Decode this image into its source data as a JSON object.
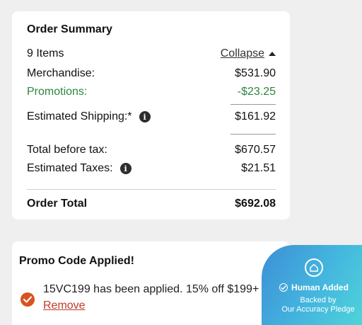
{
  "summary": {
    "title": "Order Summary",
    "items_count": "9 Items",
    "collapse_label": "Collapse",
    "merchandise": {
      "label": "Merchandise:",
      "value": "$531.90"
    },
    "promotions": {
      "label": "Promotions:",
      "value": "-$23.25"
    },
    "shipping": {
      "label": "Estimated Shipping:*",
      "value": "$161.92"
    },
    "before_tax": {
      "label": "Total before tax:",
      "value": "$670.57"
    },
    "taxes": {
      "label": "Estimated Taxes:",
      "value": "$21.51"
    },
    "order_total": {
      "label": "Order Total",
      "value": "$692.08"
    }
  },
  "promo": {
    "title": "Promo Code Applied!",
    "message": "15VC199 has been applied. 15% off $199+",
    "remove_label": "Remove"
  },
  "pledge": {
    "headline": "Human Added",
    "line1": "Backed by",
    "line2": "Our Accuracy Pledge"
  },
  "colors": {
    "promotion_green": "#2e8540",
    "accent_orange": "#d9531e",
    "remove_red": "#c0392b",
    "badge_blue": "#3d8fd6",
    "badge_teal": "#4fd3da"
  },
  "icons": {
    "info": "info-icon",
    "caret": "caret-up-icon",
    "check": "checkmark-icon",
    "pledge": "home-badge-icon"
  }
}
